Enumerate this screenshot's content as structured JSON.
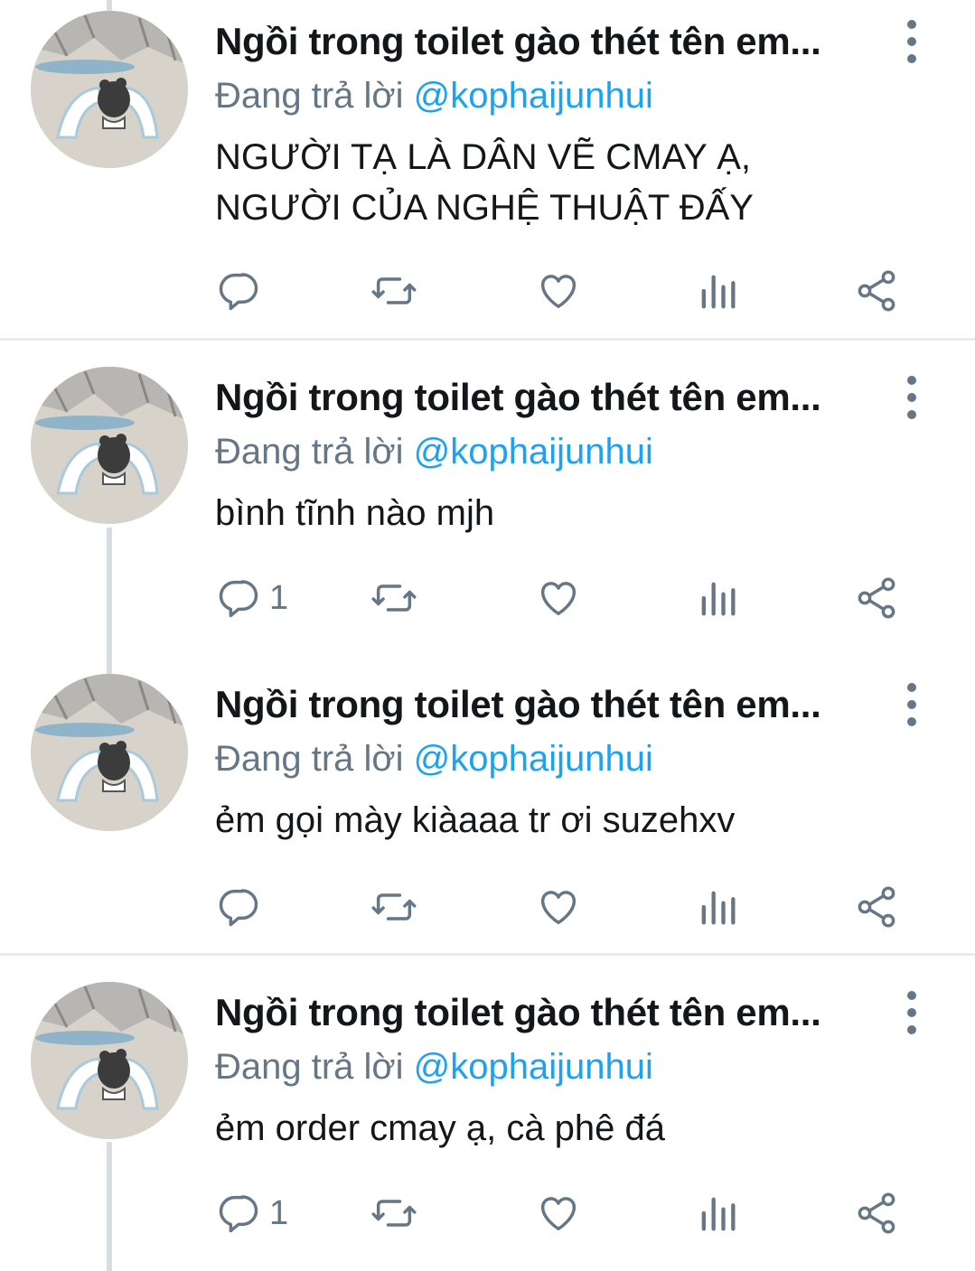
{
  "tweets": [
    {
      "name": "Ngồi trong toilet gào thét tên em...",
      "reply_prefix": "Đang trả lời",
      "reply_handle": "@kophaijunhui",
      "text_lines": [
        "NGƯỜI TẠ LÀ DÂN VẼ CMAY Ạ,",
        "NGƯỜI CỦA NGHỆ THUẬT ĐẤY"
      ],
      "reply_count": ""
    },
    {
      "name": "Ngồi trong toilet gào thét tên em...",
      "reply_prefix": "Đang trả lời",
      "reply_handle": "@kophaijunhui",
      "text_lines": [
        "bình tĩnh nào mjh"
      ],
      "reply_count": "1"
    },
    {
      "name": "Ngồi trong toilet gào thét tên em...",
      "reply_prefix": "Đang trả lời",
      "reply_handle": "@kophaijunhui",
      "text_lines": [
        "ẻm gọi mày kiàaaa tr ơi suzehxv"
      ],
      "reply_count": ""
    },
    {
      "name": "Ngồi trong toilet gào thét tên em...",
      "reply_prefix": "Đang trả lời",
      "reply_handle": "@kophaijunhui",
      "text_lines": [
        "ẻm order cmay ạ, cà phê đá"
      ],
      "reply_count": "1"
    }
  ],
  "icons": {
    "reply": "reply-icon",
    "retweet": "retweet-icon",
    "like": "heart-icon",
    "analytics": "analytics-icon",
    "share": "share-icon",
    "more": "more-vertical-icon"
  },
  "colors": {
    "name": "#14171a",
    "secondary": "#657786",
    "handle": "#1da1f2",
    "divider": "#e6ecf0"
  }
}
